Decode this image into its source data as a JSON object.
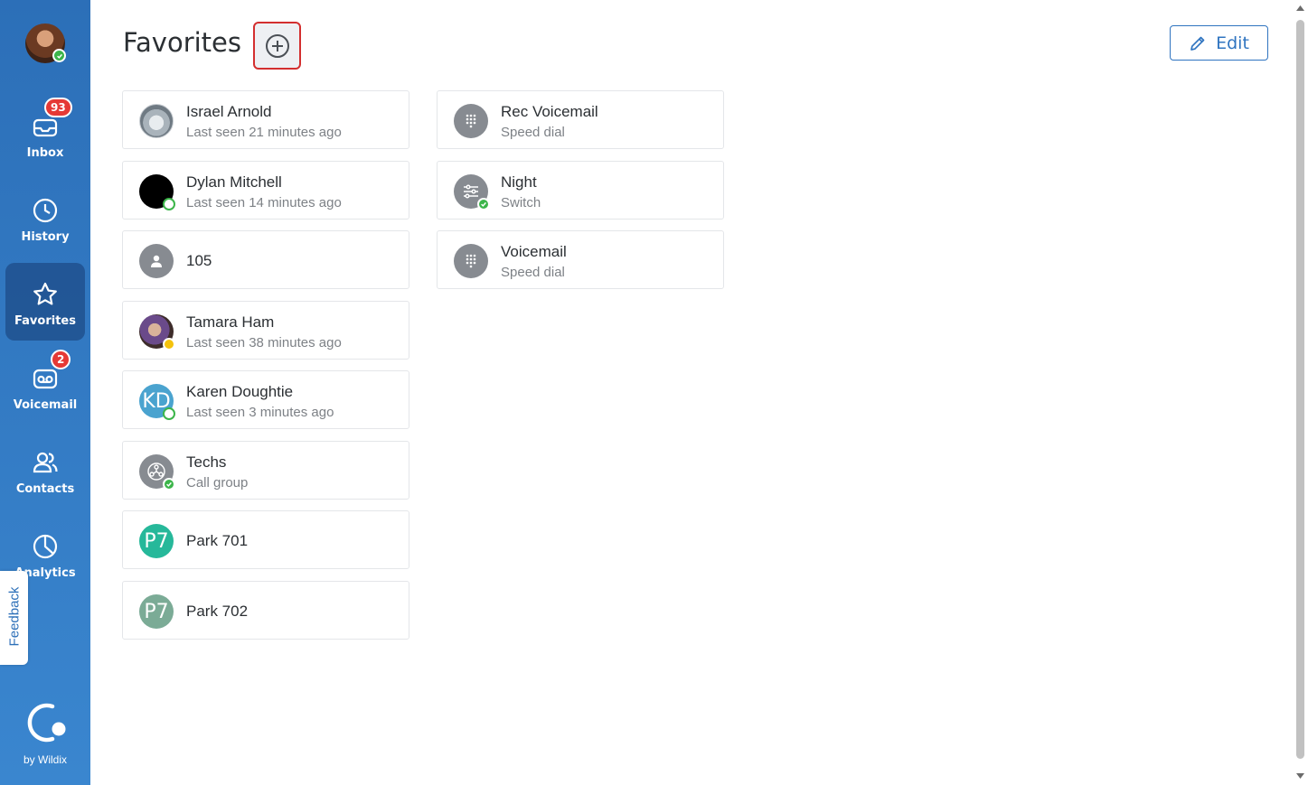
{
  "sidebar": {
    "items": [
      {
        "label": "Inbox",
        "icon": "inbox-icon",
        "badge": "93"
      },
      {
        "label": "History",
        "icon": "clock-icon"
      },
      {
        "label": "Favorites",
        "icon": "star-icon",
        "active": true
      },
      {
        "label": "Voicemail",
        "icon": "voicemail-icon",
        "badge": "2"
      },
      {
        "label": "Contacts",
        "icon": "contacts-icon"
      },
      {
        "label": "Analytics",
        "icon": "pie-chart-icon"
      }
    ],
    "feedback": "Feedback",
    "brand": "by Wildix"
  },
  "header": {
    "title": "Favorites",
    "edit_label": "Edit"
  },
  "favorites": [
    {
      "name": "Israel Arnold",
      "sub": "Last seen 21 minutes ago",
      "avatar": "photo-landscape"
    },
    {
      "name": "Dylan Mitchell",
      "sub": "Last seen 14 minutes ago",
      "avatar": "photo-black",
      "status": "online"
    },
    {
      "name": "105",
      "sub": "",
      "avatar": "user-icon"
    },
    {
      "name": "Tamara Ham",
      "sub": "Last seen 38 minutes ago",
      "avatar": "photo-person",
      "status": "away"
    },
    {
      "name": "Karen Doughtie",
      "sub": "Last seen 3 minutes ago",
      "initials": "KD",
      "status": "online"
    },
    {
      "name": "Techs",
      "sub": "Call group",
      "avatar": "call-group-icon",
      "status": "available"
    },
    {
      "name": "Park 701",
      "sub": "",
      "initials": "P7"
    },
    {
      "name": "Park 702",
      "sub": "",
      "initials": "P7"
    },
    {
      "name": "Rec Voicemail",
      "sub": "Speed dial",
      "avatar": "dialpad-icon"
    },
    {
      "name": "Night",
      "sub": "Switch",
      "avatar": "switch-icon",
      "status": "available"
    },
    {
      "name": "Voicemail",
      "sub": "Speed dial",
      "avatar": "dialpad-icon"
    }
  ],
  "colors": {
    "sidebar": "#2c6fb8",
    "accent": "#2f74c0",
    "badge": "#e53935",
    "online": "#3cb54a",
    "away": "#f4c20d",
    "kd_avatar": "#4aa3cf",
    "park701_avatar": "#26b89a",
    "park702_avatar": "#7bab96"
  }
}
